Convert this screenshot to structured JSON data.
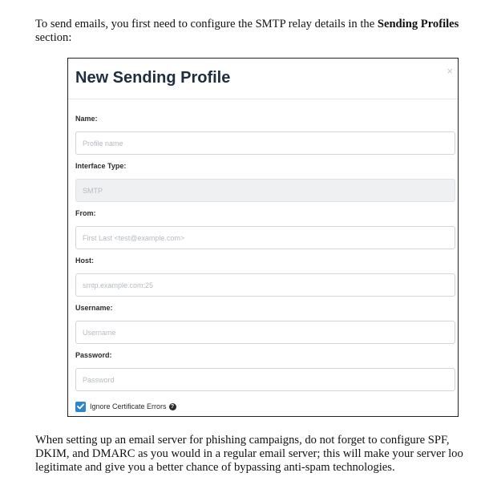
{
  "intro": {
    "before": "To send emails, you first need to configure the SMTP relay details in the ",
    "bold": "Sending Profiles",
    "after": "section:"
  },
  "modal": {
    "title": "New Sending Profile",
    "close_glyph": "×",
    "fields": {
      "name": {
        "label": "Name:",
        "placeholder": "Profile name",
        "value": ""
      },
      "interface_type": {
        "label": "Interface Type:",
        "value": "SMTP"
      },
      "from": {
        "label": "From:",
        "placeholder": "First Last <test@example.com>",
        "value": ""
      },
      "host": {
        "label": "Host:",
        "placeholder": "smtp.example.com:25",
        "value": ""
      },
      "username": {
        "label": "Username:",
        "placeholder": "Username",
        "value": ""
      },
      "password": {
        "label": "Password:",
        "placeholder": "Password",
        "value": ""
      }
    },
    "ignore_cert": {
      "label": "Ignore Certificate Errors",
      "checked": true,
      "help_glyph": "?"
    }
  },
  "outro": {
    "line1": "When setting up an email server for phishing campaigns, do not forget to configure SPF,",
    "line2": "DKIM, and DMARC as you would in a regular email server; this will make your server loo",
    "line3": "legitimate and give you a better chance of bypassing anti-spam technologies."
  },
  "colors": {
    "accent": "#2f86ca",
    "title": "#1f2d3d",
    "border": "#d2d6da"
  }
}
